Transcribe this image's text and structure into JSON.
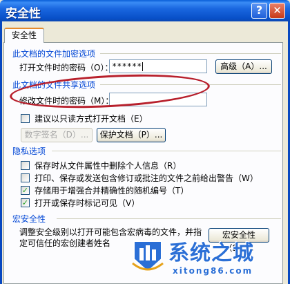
{
  "window": {
    "title": "安全性",
    "help_glyph": "?",
    "close_glyph": "✕"
  },
  "tab": {
    "label": "安全性"
  },
  "encryption": {
    "heading": "此文档的文件加密选项",
    "open_password_label": "打开文件时的密码（O）：",
    "open_password_value": "******",
    "advanced_button": "高级（A）..."
  },
  "sharing": {
    "heading": "此文档的文件共享选项",
    "modify_password_label": "修改文件时的密码（M）：",
    "modify_password_value": "",
    "readonly_label": "建议以只读方式打开文档（E）",
    "readonly_checked": false,
    "digital_signature_button": "数字签名（D）...",
    "protect_document_button": "保护文档（P）..."
  },
  "privacy": {
    "heading": "隐私选项",
    "items": [
      {
        "label": "保存时从文件属性中删除个人信息（R）",
        "checked": false
      },
      {
        "label": "打印、保存或发送包含修订或批注的文件之前给出警告（W）",
        "checked": false
      },
      {
        "label": "存储用于增强合并精确性的随机编号（T）",
        "checked": true
      },
      {
        "label": "打开或保存时标记可见（V）",
        "checked": true
      }
    ]
  },
  "macro": {
    "heading": "宏安全性",
    "description_line1": "调整安全级别以打开可能包含宏病毒的文件，并指",
    "description_line2": "定可信任的宏创建者姓名",
    "macro_security_button": "宏安全性（S）..."
  },
  "watermark": {
    "text": "系统之城",
    "url": "xitong86.com"
  },
  "colors": {
    "accent_heading": "#0046d5",
    "titlebar": "#0a5fd8",
    "annotation": "#b8202c",
    "check": "#21a121"
  }
}
